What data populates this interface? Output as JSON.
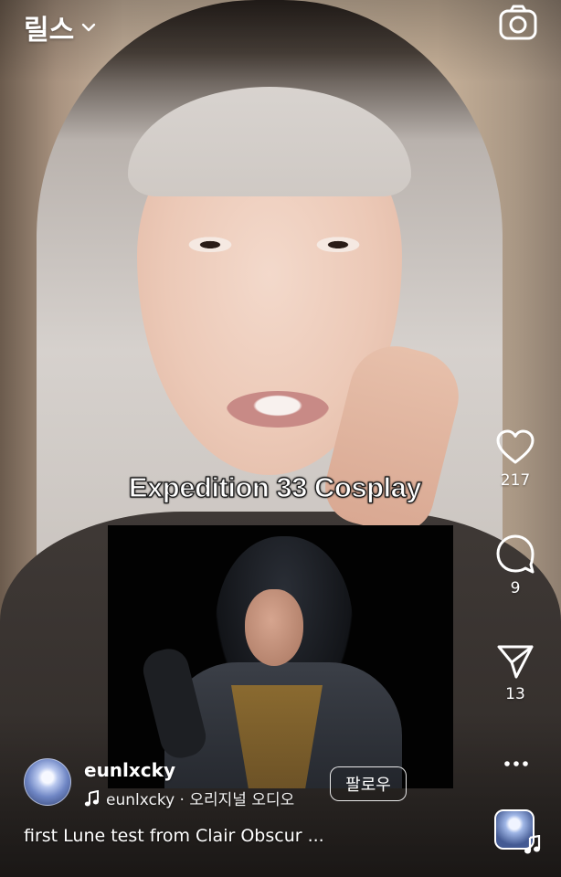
{
  "header": {
    "title": "릴스",
    "title_icon": "chevron-down-icon",
    "camera_icon": "camera-icon"
  },
  "video": {
    "overlay_text": "Expedition 33 Cosplay"
  },
  "actions": {
    "like": {
      "icon": "heart-icon",
      "count": "217"
    },
    "comment": {
      "icon": "comment-icon",
      "count": "9"
    },
    "share": {
      "icon": "send-icon",
      "count": "13"
    },
    "more": {
      "icon": "more-icon"
    },
    "audio": {
      "icon": "music-note-icon"
    }
  },
  "author": {
    "username": "eunlxcky",
    "audio_label": "eunlxcky · 오리지널 오디오",
    "follow_label": "팔로우"
  },
  "caption": "first Lune test from Clair Obscur ...",
  "colors": {
    "text": "#ffffff",
    "background": "#c9b49d"
  }
}
